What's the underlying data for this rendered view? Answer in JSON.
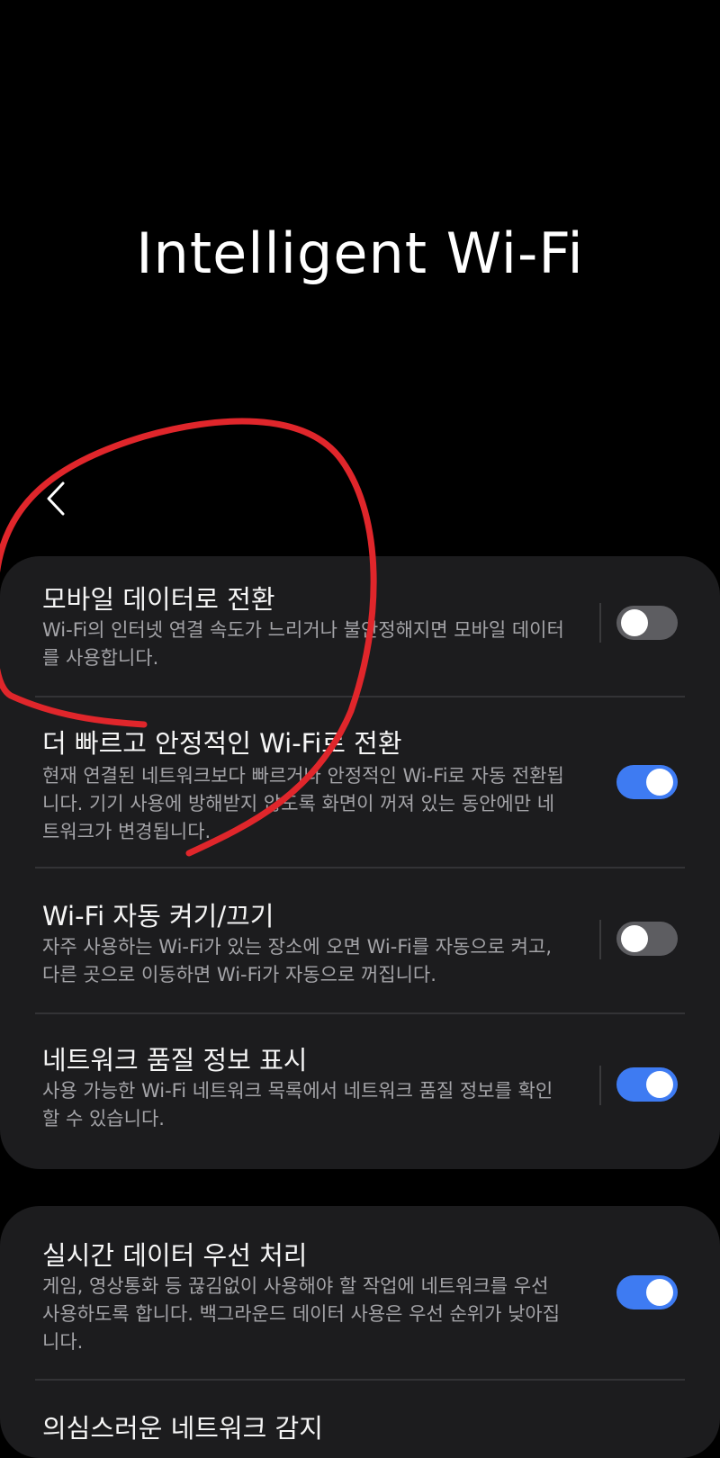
{
  "page": {
    "title": "Intelligent Wi-Fi"
  },
  "colors": {
    "background": "#000000",
    "card": "#1c1c1e",
    "toggle_on": "#3e7bf2",
    "toggle_off": "#5d5d61",
    "annotation_stroke": "#e0262b"
  },
  "settings_group_1": {
    "items": [
      {
        "title": "모바일 데이터로 전환",
        "description": "Wi-Fi의 인터넷 연결 속도가 느리거나 불안정해지면 모바일 데이터를 사용합니다.",
        "enabled": false
      },
      {
        "title": "더 빠르고 안정적인 Wi-Fi로 전환",
        "description": "현재 연결된 네트워크보다 빠르거나 안정적인 Wi-Fi로 자동 전환됩니다. 기기 사용에 방해받지 않도록 화면이 꺼져 있는 동안에만 네트워크가 변경됩니다.",
        "enabled": true
      },
      {
        "title": "Wi-Fi 자동 켜기/끄기",
        "description": "자주 사용하는 Wi-Fi가 있는 장소에 오면 Wi-Fi를 자동으로 켜고, 다른 곳으로 이동하면 Wi-Fi가 자동으로 꺼집니다.",
        "enabled": false
      },
      {
        "title": "네트워크 품질 정보 표시",
        "description": "사용 가능한 Wi-Fi 네트워크 목록에서 네트워크 품질 정보를 확인할 수 있습니다.",
        "enabled": true
      }
    ]
  },
  "settings_group_2": {
    "items": [
      {
        "title": "실시간 데이터 우선 처리",
        "description": "게임, 영상통화 등 끊김없이 사용해야 할 작업에 네트워크를 우선 사용하도록 합니다. 백그라운드 데이터 사용은 우선 순위가 낮아집니다.",
        "enabled": true
      },
      {
        "title": "의심스러운 네트워크 감지"
      }
    ]
  }
}
